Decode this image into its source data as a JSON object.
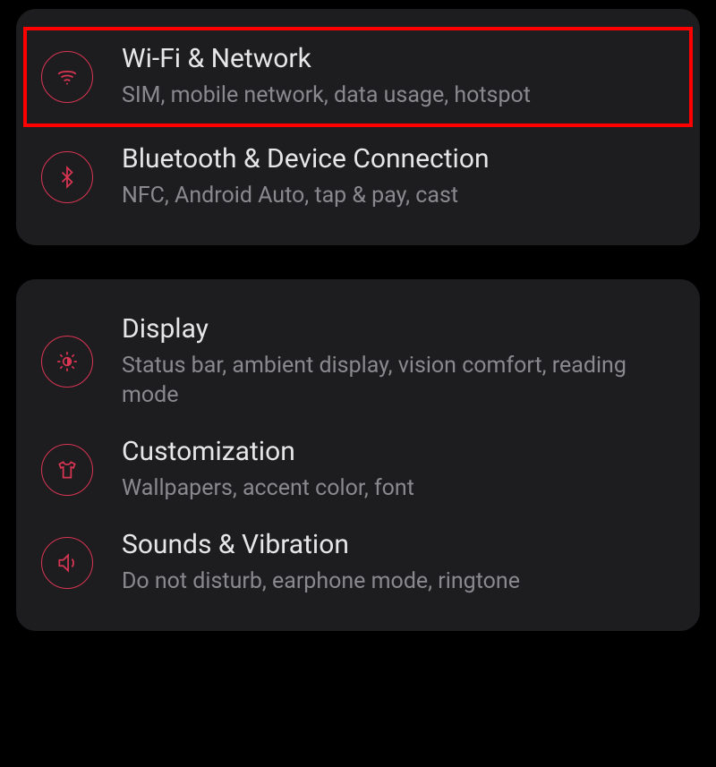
{
  "groups": [
    {
      "items": [
        {
          "key": "wifi-network",
          "title": "Wi-Fi & Network",
          "subtitle": "SIM, mobile network, data usage, hotspot",
          "icon": "wifi",
          "highlighted": true
        },
        {
          "key": "bluetooth-device",
          "title": "Bluetooth & Device Connection",
          "subtitle": "NFC, Android Auto, tap & pay, cast",
          "icon": "bluetooth",
          "highlighted": false
        }
      ]
    },
    {
      "items": [
        {
          "key": "display",
          "title": "Display",
          "subtitle": "Status bar, ambient display, vision comfort, reading mode",
          "icon": "brightness",
          "highlighted": false
        },
        {
          "key": "customization",
          "title": "Customization",
          "subtitle": "Wallpapers, accent color, font",
          "icon": "tshirt",
          "highlighted": false
        },
        {
          "key": "sounds-vibration",
          "title": "Sounds & Vibration",
          "subtitle": "Do not disturb, earphone mode, ringtone",
          "icon": "speaker",
          "highlighted": false
        }
      ]
    }
  ],
  "colors": {
    "accent": "#d93553",
    "highlight_border": "#ff0000",
    "card_bg": "#1d1d1f",
    "title_text": "#e6e6e8",
    "subtitle_text": "#8a8a8e"
  }
}
